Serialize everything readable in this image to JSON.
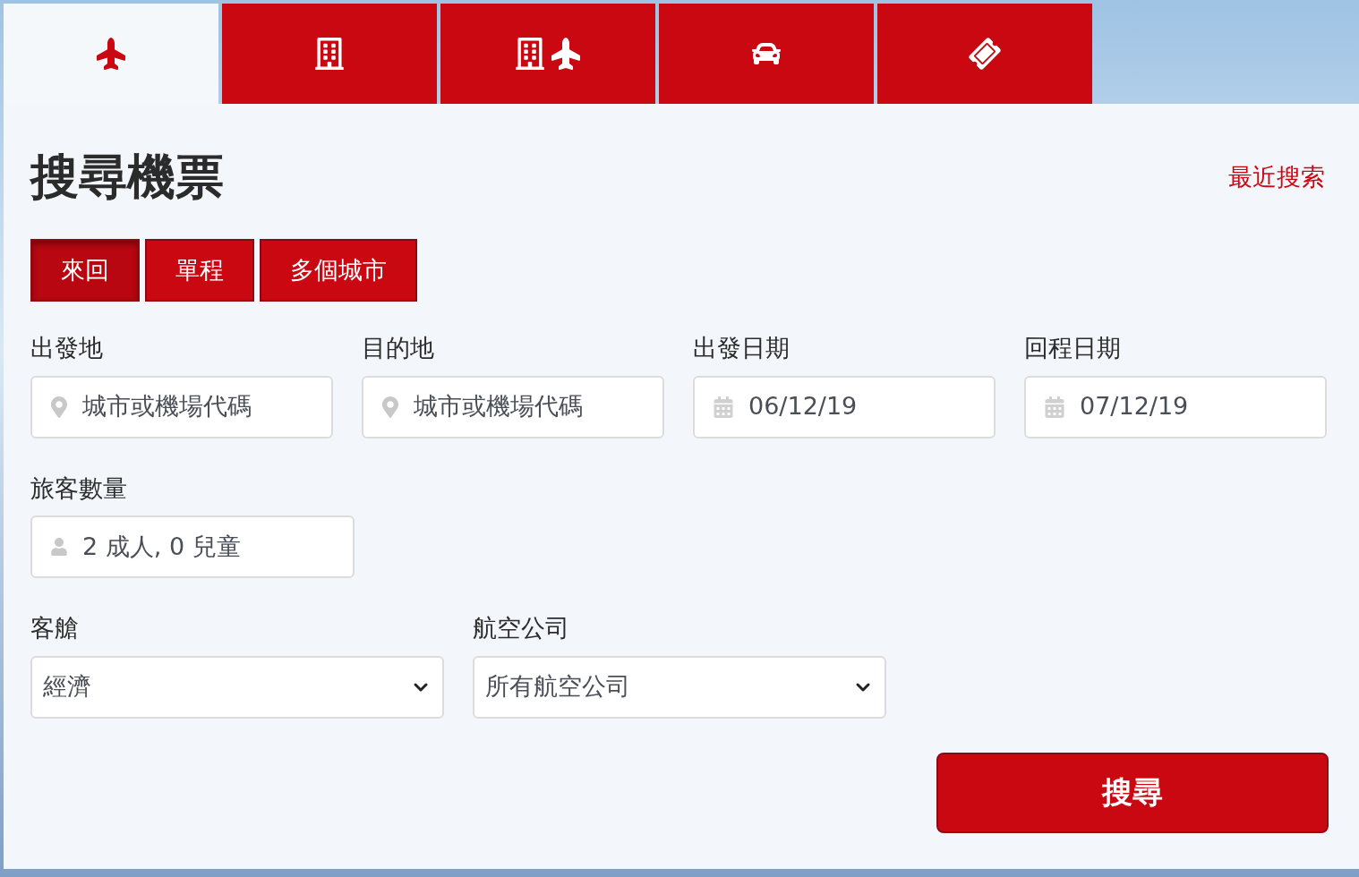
{
  "tabs": [
    {
      "kind": "flight",
      "selected": true
    },
    {
      "kind": "hotel",
      "selected": false
    },
    {
      "kind": "hotel_flight",
      "selected": false
    },
    {
      "kind": "car",
      "selected": false
    },
    {
      "kind": "ticket",
      "selected": false
    }
  ],
  "title": "搜尋機票",
  "recent_link": "最近搜索",
  "trip_types": [
    {
      "label": "來回",
      "selected": true
    },
    {
      "label": "單程",
      "selected": false
    },
    {
      "label": "多個城市",
      "selected": false
    }
  ],
  "fields": [
    {
      "kind": "location",
      "label": "出發地",
      "placeholder": "城市或機場代碼"
    },
    {
      "kind": "location",
      "label": "目的地",
      "placeholder": "城市或機場代碼"
    },
    {
      "kind": "date",
      "label": "出發日期",
      "value": "06/12/19"
    },
    {
      "kind": "date",
      "label": "回程日期",
      "value": "07/12/19"
    }
  ],
  "travelers": {
    "label": "旅客數量",
    "value": "2 成人, 0 兒童"
  },
  "selects": [
    {
      "label": "客艙",
      "value": "經濟"
    },
    {
      "label": "航空公司",
      "value": "所有航空公司"
    }
  ],
  "search_button": "搜尋"
}
